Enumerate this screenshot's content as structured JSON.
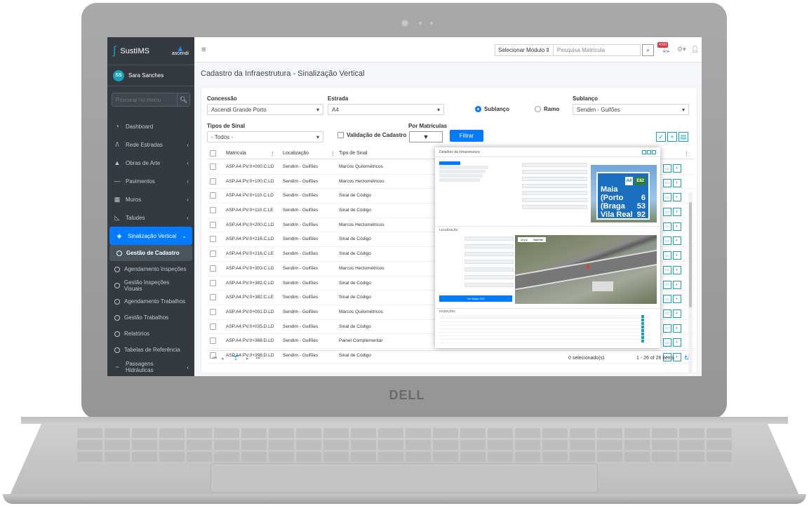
{
  "laptop": {
    "brand": "DELL"
  },
  "app": {
    "name": "SustIMS",
    "logo_text": "ascendi"
  },
  "user": {
    "initials": "SS",
    "name": "Sara Sanches"
  },
  "sidebar": {
    "search_placeholder": "Procurar no menu",
    "items": [
      {
        "label": "Dashboard",
        "icon": "dashboard-icon"
      },
      {
        "label": "Rede Estradas",
        "icon": "road-icon"
      },
      {
        "label": "Obras de Arte",
        "icon": "bridge-icon"
      },
      {
        "label": "Pavimentos",
        "icon": "pavement-icon"
      },
      {
        "label": "Muros",
        "icon": "wall-icon"
      },
      {
        "label": "Taludes",
        "icon": "slope-icon"
      },
      {
        "label": "Sinalização Vertical",
        "icon": "sign-icon"
      }
    ],
    "subitems": [
      "Gestão de Cadastro",
      "Agendamento Inspeções",
      "Gestão Inspeções Visuais",
      "Agendamento Trabalhos",
      "Gestão Trabalhos",
      "Relatórios",
      "Tabelas de Referência"
    ],
    "last_item": "Passagens Hidráulicas"
  },
  "topbar": {
    "module_select": "Selecionar Módulo",
    "search_placeholder": "Pesquisa Matrícula",
    "notifications": "4100"
  },
  "page": {
    "title": "Cadastro da Infraestrutura - Sinalização Vertical"
  },
  "filters": {
    "concessao_label": "Concessão",
    "concessao_value": "Ascendi Grande Porto",
    "estrada_label": "Estrada",
    "estrada_value": "A4",
    "sublanco_radio": "Sublanço",
    "ramo_radio": "Ramo",
    "sublanco_label": "Sublanço",
    "sublanco_value": "Sendim - Guifões",
    "tipos_label": "Tipos de Sinal",
    "tipos_value": "- Todos -",
    "validacao_label": "Validação de Cadastro",
    "matriculas_label": "Por Matrículas",
    "filter_button": "Filtrar"
  },
  "table": {
    "columns": [
      "Matrícula",
      "Localização",
      "Tipo de Sinal"
    ],
    "rows": [
      [
        "ASP.A4.PV.0+000.C.LD",
        "Sendim - Guifões",
        "Marcos Quilométricos"
      ],
      [
        "ASP.A4.PV.0+100.C.LD",
        "Sendim - Guifões",
        "Marcos Hectométricos"
      ],
      [
        "ASP.A4.PV.0+110.C.LD",
        "Sendim - Guifões",
        "Sinal de Código"
      ],
      [
        "ASP.A4.PV.0+110.C.LE",
        "Sendim - Guifões",
        "Sinal de Código"
      ],
      [
        "ASP.A4.PV.0+200.C.LD",
        "Sendim - Guifões",
        "Marcos Hectométricos"
      ],
      [
        "ASP.A4.PV.0+216.C.LD",
        "Sendim - Guifões",
        "Sinal de Código"
      ],
      [
        "ASP.A4.PV.0+216.C.LE",
        "Sendim - Guifões",
        "Sinal de Código"
      ],
      [
        "ASP.A4.PV.0+303.C.LD",
        "Sendim - Guifões",
        "Marcos Hectométricos"
      ],
      [
        "ASP.A4.PV.0+382.C.LD",
        "Sendim - Guifões",
        "Sinal de Código"
      ],
      [
        "ASP.A4.PV.0+382.C.LE",
        "Sendim - Guifões",
        "Sinal de Código"
      ],
      [
        "ASP.A4.PV.0+001.D.LD",
        "Sendim - Guifões",
        "Marcos Quilométricos"
      ],
      [
        "ASP.A4.PV.0+035.D.LD",
        "Sendim - Guifões",
        "Sinal de Código"
      ],
      [
        "ASP.A4.PV.0+368.D.LD",
        "Sendim - Guifões",
        "Painel Complementar"
      ],
      [
        "ASP.A4.PV.0+398.D.LD",
        "Sendim - Guifões",
        "Sinal de Código"
      ]
    ],
    "page_number": "1",
    "selected": "0 selecionado(s)",
    "items_info": "1 - 26 of 26 items"
  },
  "popup": {
    "title": "Detalhes da Infraestrutura",
    "location_section": "Localização",
    "inspections_section": "Inspeções",
    "map_tab_map": "Mapa",
    "map_tab_sat": "Satélite",
    "map_button": "Ver Mapa GIS",
    "sign": {
      "route": "A4",
      "route2": "E82",
      "lines": [
        "Maia",
        "(Porto",
        "(Braga",
        "Vila Real"
      ],
      "nums": [
        "6",
        "53",
        "92"
      ]
    }
  },
  "colors": {
    "primary": "#007bff",
    "teal": "#17a2b8",
    "sidebar": "#343a40"
  }
}
